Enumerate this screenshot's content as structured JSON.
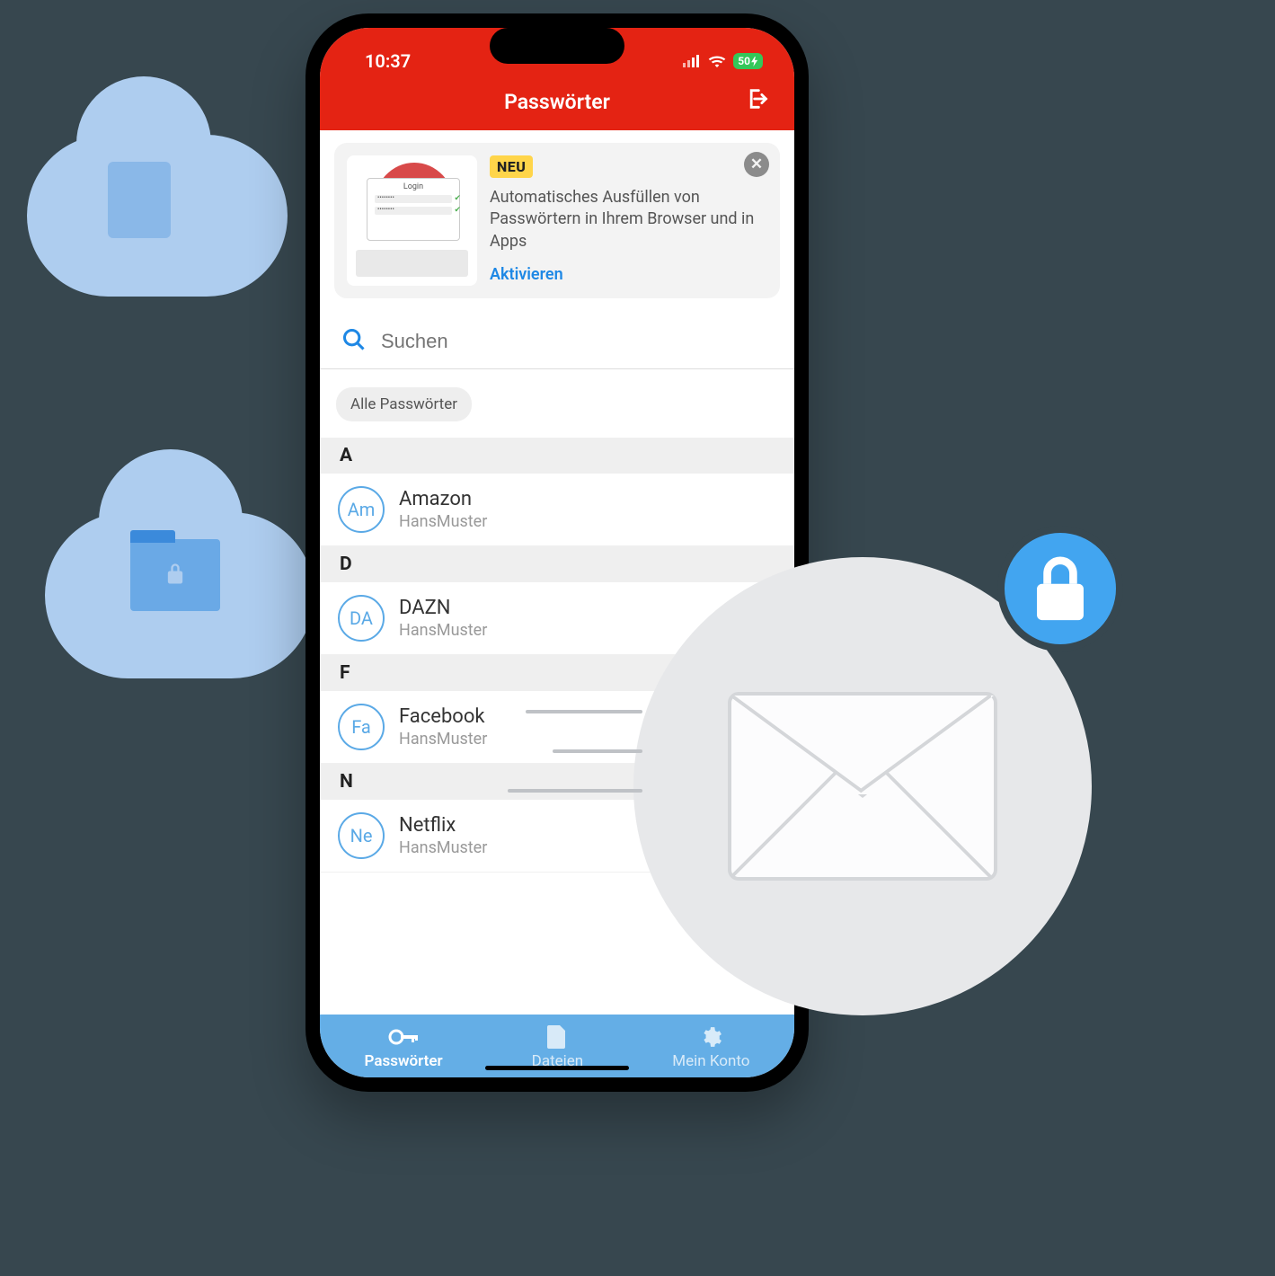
{
  "status": {
    "time": "10:37",
    "battery": "50"
  },
  "header": {
    "title": "Passwörter"
  },
  "banner": {
    "badge": "NEU",
    "login_label": "Login",
    "text": "Automatisches Ausfüllen von Passwörtern in Ihrem Browser und in Apps",
    "action": "Aktivieren"
  },
  "search": {
    "placeholder": "Suchen"
  },
  "filter": {
    "chip": "Alle Passwörter"
  },
  "sections": [
    {
      "letter": "A",
      "entries": [
        {
          "abbr": "Am",
          "name": "Amazon",
          "user": "HansMuster"
        }
      ]
    },
    {
      "letter": "D",
      "entries": [
        {
          "abbr": "DA",
          "name": "DAZN",
          "user": "HansMuster"
        }
      ]
    },
    {
      "letter": "F",
      "entries": [
        {
          "abbr": "Fa",
          "name": "Facebook",
          "user": "HansMuster"
        }
      ]
    },
    {
      "letter": "N",
      "entries": [
        {
          "abbr": "Ne",
          "name": "Netflix",
          "user": "HansMuster"
        }
      ]
    }
  ],
  "tabs": {
    "passwords": "Passwörter",
    "files": "Dateien",
    "account": "Mein Konto"
  }
}
